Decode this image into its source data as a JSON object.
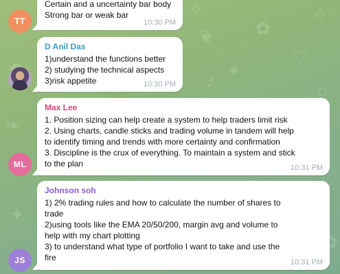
{
  "messages": [
    {
      "avatar_initials": "TT",
      "avatar_color": "#f0905f",
      "sender": "",
      "lines": [
        "Certain and a uncertainty bar body",
        "Strong bar or weak bar"
      ],
      "time": "10:30 PM"
    },
    {
      "avatar_initials": "",
      "avatar_color": "#7d6b93",
      "sender": "D Anil Das",
      "sender_color": "#3b9ac4",
      "lines": [
        "1)understand the functions better",
        "2) studying the technical aspects",
        "3)risk appetite"
      ],
      "time": "10:30 PM"
    },
    {
      "avatar_initials": "ML",
      "avatar_color": "#e56c9c",
      "sender": "Max Lee",
      "sender_color": "#d9457a",
      "lines": [
        "1. Position sizing can help create a system to help traders limit risk",
        "2. Using charts, candle sticks and trading volume in tandem will help",
        "to identify timing and trends with more certainty and confirmation",
        "3. Discipline is the crux of everything. To maintain a system and stick",
        "to the plan"
      ],
      "time": "10:31 PM"
    },
    {
      "avatar_initials": "JS",
      "avatar_color": "#9c7fd6",
      "sender": "Johnson soh",
      "sender_color": "#8a5fd0",
      "lines": [
        "1) 2% trading rules and how to calculate the number of shares to",
        "trade",
        "2)using tools like the EMA 20/50/200, margin avg and volume to",
        "help with my chart plotting",
        "3) to understand what type of portfolio I want to take and use the",
        "fire"
      ],
      "time": "10:31 PM"
    }
  ]
}
